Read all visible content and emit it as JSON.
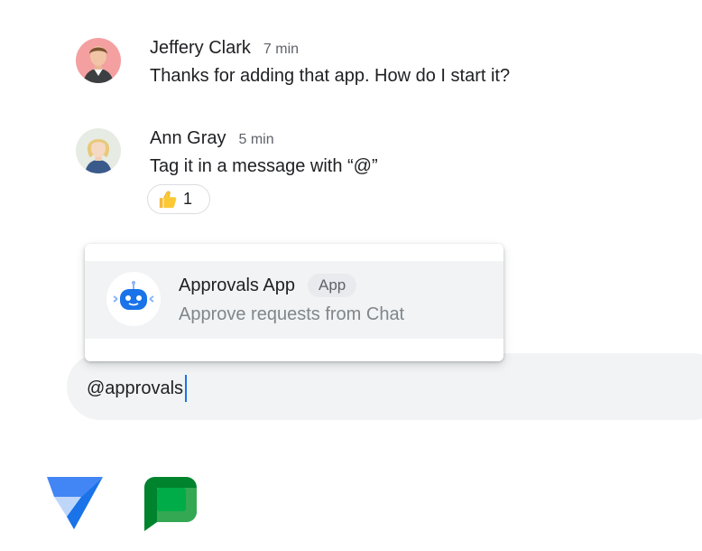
{
  "messages": [
    {
      "author": "Jeffery Clark",
      "time": "7 min",
      "text": "Thanks for adding that app. How do I start it?",
      "avatar_icon": "avatar-jeffery"
    },
    {
      "author": "Ann Gray",
      "time": "5 min",
      "text": "Tag it in a message with “@”",
      "avatar_icon": "avatar-ann",
      "reaction": {
        "emoji_icon": "thumbs-up-icon",
        "count": "1"
      }
    }
  ],
  "suggestion": {
    "name": "Approvals App",
    "badge": "App",
    "description": "Approve requests from Chat",
    "icon": "robot-icon"
  },
  "compose": {
    "value": "@approvals"
  },
  "logos": [
    "appsheet-logo",
    "google-chat-logo"
  ],
  "colors": {
    "accent": "#1a73e8",
    "panel_highlight": "#f1f3f4",
    "muted_text": "#5f6368",
    "chat_green_dark": "#00832d",
    "chat_green_light": "#34a853"
  }
}
